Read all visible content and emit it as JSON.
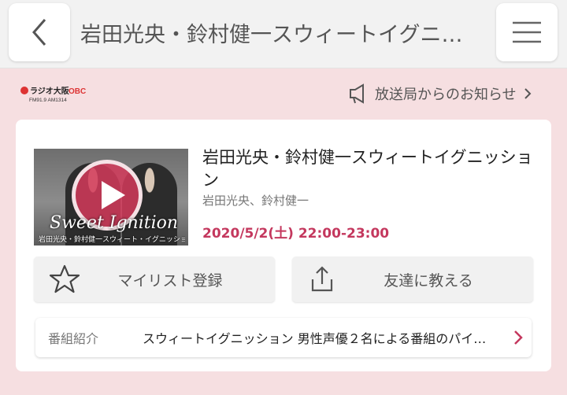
{
  "header": {
    "title": "岩田光央・鈴村健一スウィートイグニ…"
  },
  "station": {
    "logo_alt": "ラジオ大阪 OBC FM91.9 AM1314",
    "notice_label": "放送局からのお知らせ"
  },
  "program": {
    "title": "岩田光央・鈴村健一スウィートイグニッション",
    "performers": "岩田光央、鈴村健一",
    "datetime": "2020/5/2(土) 22:00-23:00",
    "thumb_logo": "Sweet Ignition",
    "thumb_sub": "岩田光央・鈴村健一スウィート・イグニッション"
  },
  "actions": {
    "mylist_label": "マイリスト登録",
    "share_label": "友達に教える"
  },
  "intro": {
    "label": "番組紹介",
    "text": "スウィートイグニッション 男性声優２名による番組のパイ…"
  },
  "colors": {
    "accent": "#c4385e",
    "background": "#f6dfe1"
  }
}
